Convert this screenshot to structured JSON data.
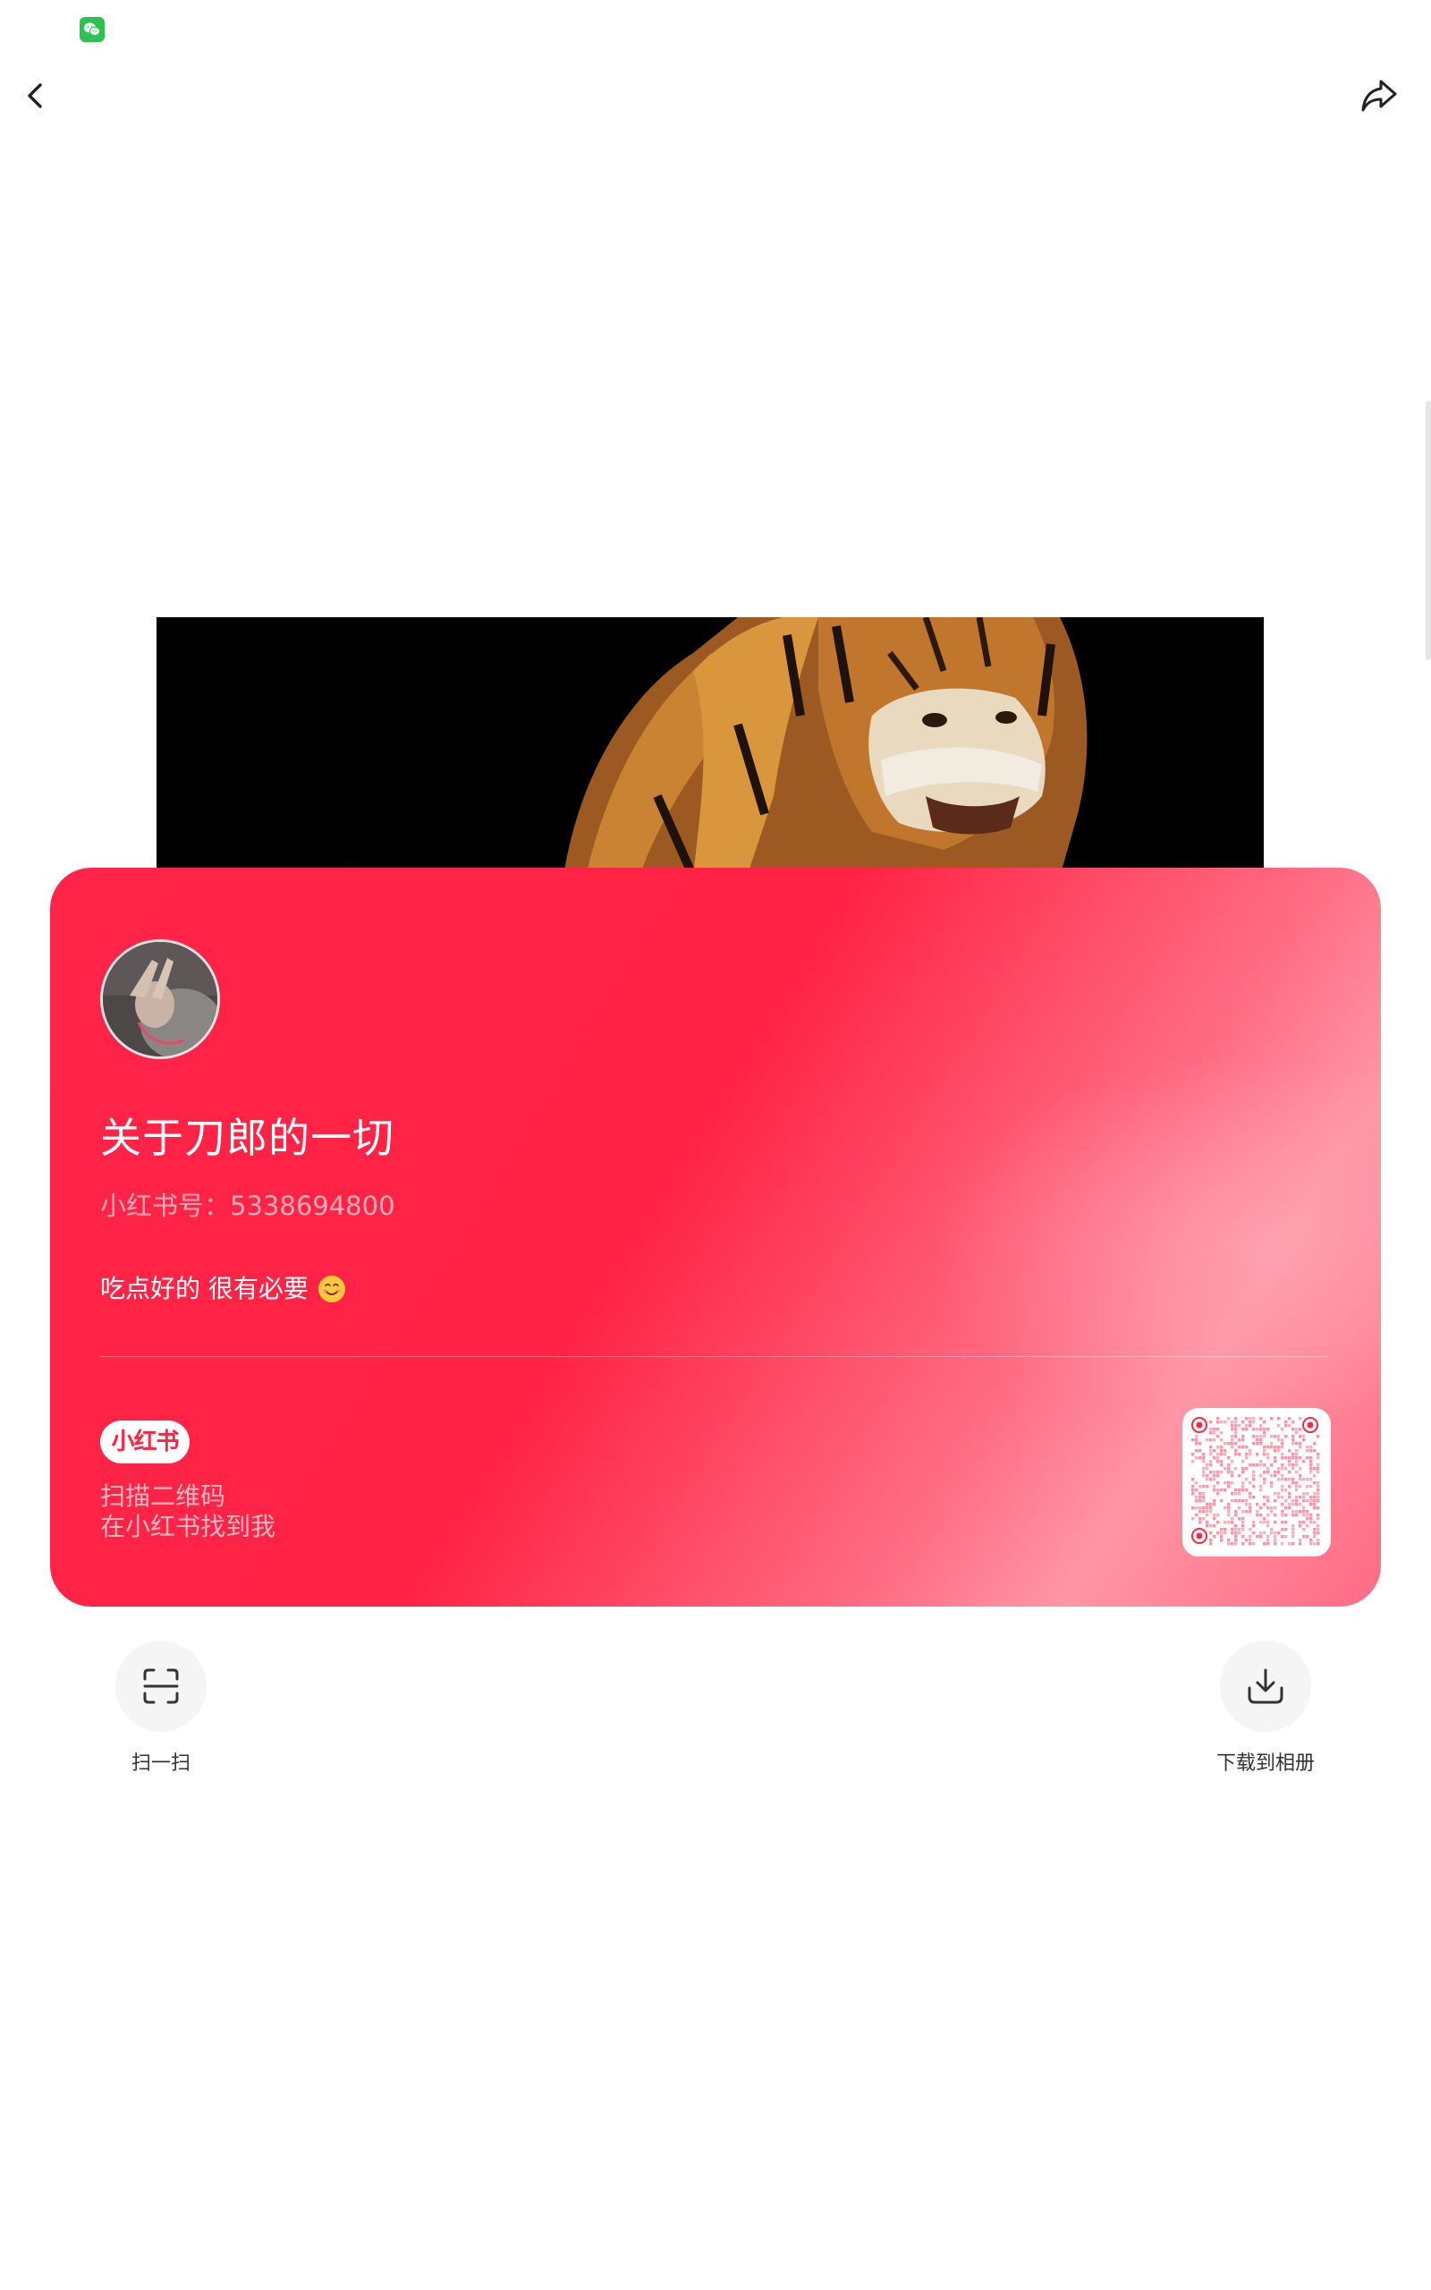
{
  "header": {
    "status_app_icon": "wechat-icon",
    "back_icon": "chevron-left-icon",
    "share_icon": "share-arrow-icon"
  },
  "cover": {
    "image": "tiger-image"
  },
  "card": {
    "background_color": "#ff2442",
    "name": "关于刀郎的一切",
    "id_label": "小红书号：",
    "id_value": "5338694800",
    "bio": "吃点好的 很有必要",
    "bio_emoji": "smiling-face-emoji",
    "brand_logo": "小红书",
    "scan_hint_line1": "扫描二维码",
    "scan_hint_line2": "在小红书找到我",
    "qr_icon": "qr-code-icon"
  },
  "actions": [
    {
      "label": "扫一扫",
      "icon": "scan-icon"
    },
    {
      "label": "下载到相册",
      "icon": "download-icon"
    }
  ]
}
